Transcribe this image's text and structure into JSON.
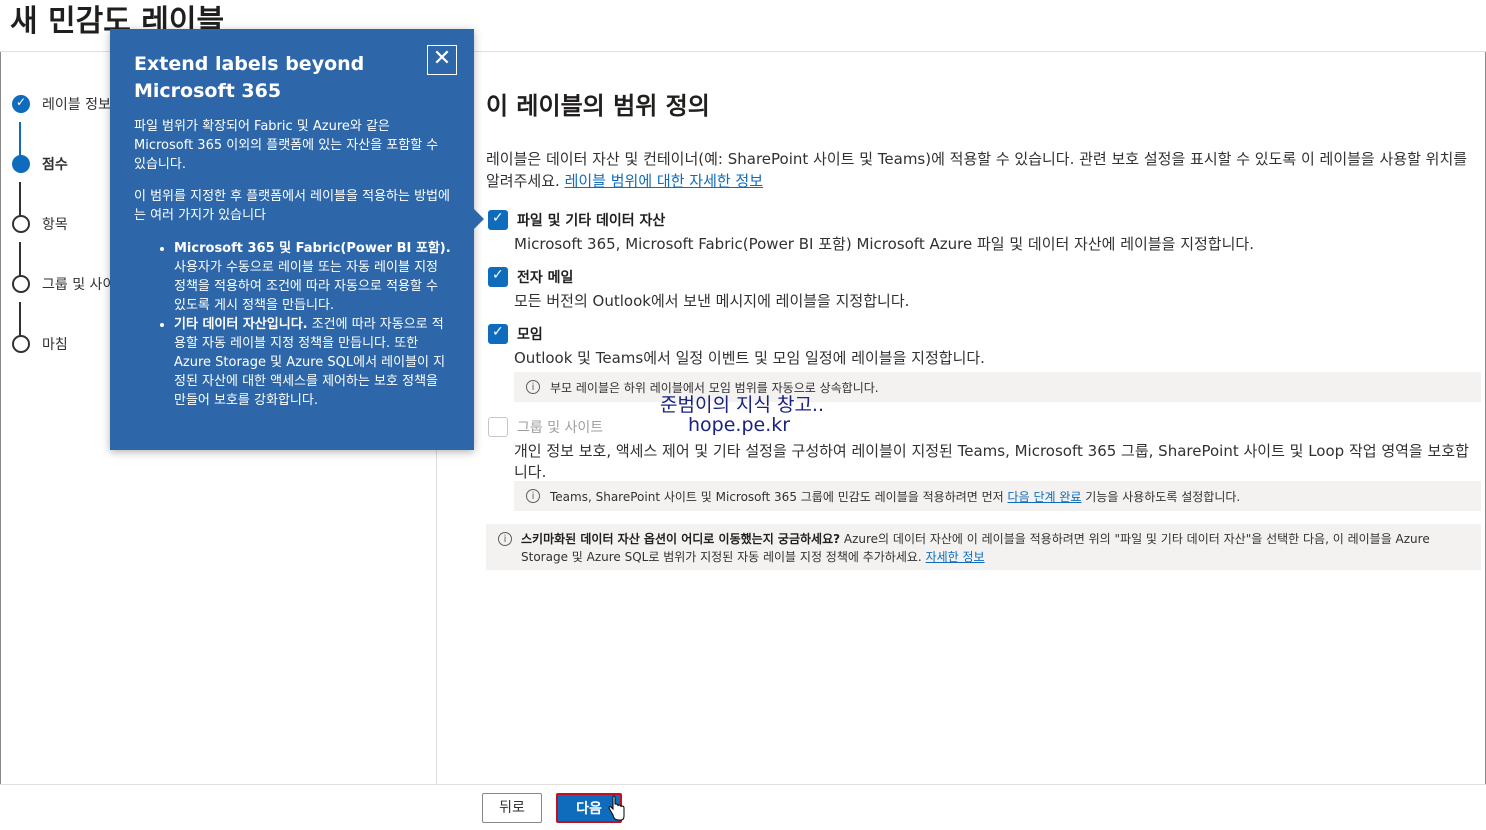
{
  "page": {
    "title": "새 민감도 레이블"
  },
  "steps": [
    {
      "label": "레이블 정보",
      "state": "done"
    },
    {
      "label": "점수",
      "state": "current"
    },
    {
      "label": "항목",
      "state": "pending"
    },
    {
      "label": "그룹 및 사이트",
      "state": "pending"
    },
    {
      "label": "마침",
      "state": "pending"
    }
  ],
  "main": {
    "heading": "이 레이블의 범위 정의",
    "intro": "레이블은 데이터 자산 및 컨테이너(예: SharePoint 사이트 및 Teams)에 적용할 수 있습니다. 관련 보호 설정을 표시할 수 있도록 이 레이블을 사용할 위치를 알려주세요.",
    "intro_link": "레이블 범위에 대한 자세한 정보",
    "options": [
      {
        "name": "파일 및 기타 데이터 자산",
        "checked": true,
        "desc": "Microsoft 365, Microsoft Fabric(Power BI 포함) Microsoft Azure 파일 및 데이터 자산에 레이블을 지정합니다."
      },
      {
        "name": "전자 메일",
        "checked": true,
        "desc": "모든 버전의 Outlook에서 보낸 메시지에 레이블을 지정합니다."
      },
      {
        "name": "모임",
        "checked": true,
        "desc": "Outlook 및 Teams에서 일정 이벤트 및 모임 일정에 레이블을 지정합니다.",
        "info": "부모 레이블은 하위 레이블에서 모임 범위를 자동으로 상속합니다."
      },
      {
        "name": "그룹 및 사이트",
        "checked": false,
        "disabled": true,
        "desc": "개인 정보 보호, 액세스 제어 및 기타 설정을 구성하여 레이블이 지정된 Teams, Microsoft 365 그룹, SharePoint 사이트 및 Loop 작업 영역을 보호합니다.",
        "info_pre": "Teams, SharePoint 사이트 및 Microsoft 365 그룹에 민감도 레이블을 적용하려면 먼저",
        "info_link": "다음 단계 완료",
        "info_post": "기능을 사용하도록 설정합니다."
      }
    ],
    "schematized": {
      "bold": "스키마화된 데이터 자산 옵션이 어디로 이동했는지 궁금하세요?",
      "text": " Azure의 데이터 자산에 이 레이블을 적용하려면 위의 \"파일 및 기타 데이터 자산\"을 선택한 다음, 이 레이블을 Azure Storage 및 Azure SQL로 범위가 지정된 자동 레이블 지정 정책에 추가하세요. ",
      "link": "자세한 정보"
    }
  },
  "watermark": {
    "line1": "준범이의 지식 창고..",
    "line2": "hope.pe.kr"
  },
  "footer": {
    "back": "뒤로",
    "next": "다음"
  },
  "bubble": {
    "title": "Extend labels beyond Microsoft 365",
    "close_glyph": "✕",
    "p1": "파일 범위가 확장되어 Fabric 및 Azure와 같은 Microsoft 365 이외의 플랫폼에 있는 자산을 포함할 수 있습니다.",
    "p2": "이 범위를 지정한 후 플랫폼에서 레이블을 적용하는 방법에는 여러 가지가 있습니다",
    "items": [
      {
        "bold": "Microsoft 365 및 Fabric(Power BI 포함).",
        "text": " 사용자가 수동으로 레이블 또는 자동 레이블 지정 정책을 적용하여 조건에 따라 자동으로 적용할 수 있도록 게시 정책을 만듭니다."
      },
      {
        "bold": "기타 데이터 자산입니다.",
        "text": " 조건에 따라 자동으로 적용할 자동 레이블 지정 정책을 만듭니다. 또한 Azure Storage 및 Azure SQL에서 레이블이 지정된 자산에 대한 액세스를 제어하는 보호 정책을 만들어 보호를 강화합니다."
      }
    ]
  },
  "colors": {
    "accent": "#0f6cbd",
    "bubble": "#2d67a9",
    "highlight": "#c50f1f"
  }
}
